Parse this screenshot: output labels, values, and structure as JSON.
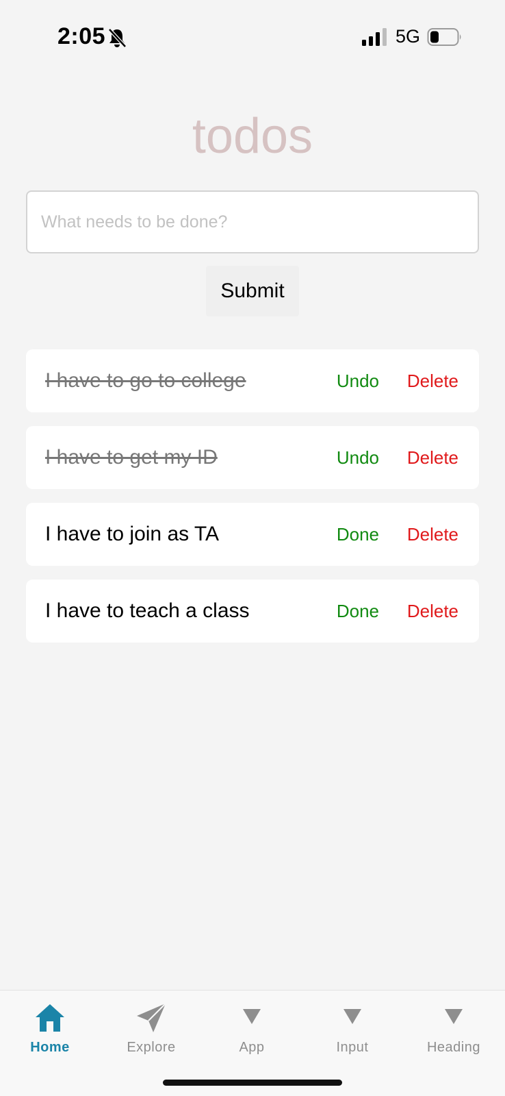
{
  "status_bar": {
    "time": "2:05",
    "network": "5G"
  },
  "header": {
    "title": "todos"
  },
  "input": {
    "placeholder": "What needs to be done?",
    "value": ""
  },
  "submit_label": "Submit",
  "todos": [
    {
      "text": "I have to go to college",
      "completed": true,
      "toggle_label": "Undo",
      "delete_label": "Delete"
    },
    {
      "text": "I have to get my ID",
      "completed": true,
      "toggle_label": "Undo",
      "delete_label": "Delete"
    },
    {
      "text": "I have to join as TA",
      "completed": false,
      "toggle_label": "Done",
      "delete_label": "Delete"
    },
    {
      "text": "I have to teach a class",
      "completed": false,
      "toggle_label": "Done",
      "delete_label": "Delete"
    }
  ],
  "tab_bar": {
    "tabs": [
      {
        "label": "Home",
        "icon": "home-icon",
        "active": true
      },
      {
        "label": "Explore",
        "icon": "paper-plane-icon",
        "active": false
      },
      {
        "label": "App",
        "icon": "triangle-down-icon",
        "active": false
      },
      {
        "label": "Input",
        "icon": "triangle-down-icon",
        "active": false
      },
      {
        "label": "Heading",
        "icon": "triangle-down-icon",
        "active": false
      }
    ]
  },
  "colors": {
    "title": "#d6c2c2",
    "action_green": "#118a11",
    "delete_red": "#e0191b",
    "tab_active": "#1b84a8",
    "tab_inactive": "#8e8e8e"
  }
}
